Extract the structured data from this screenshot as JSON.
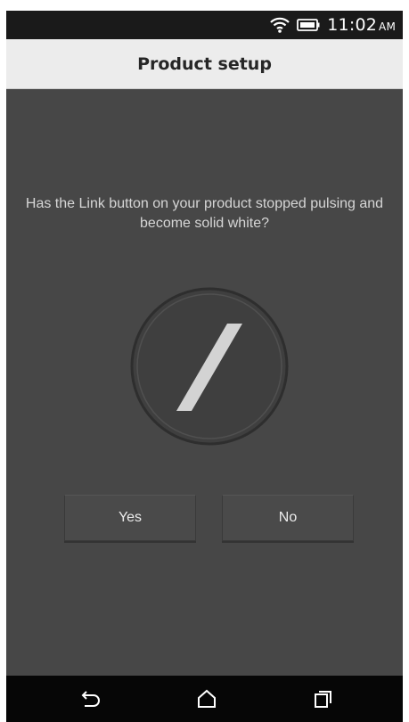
{
  "status_bar": {
    "time": "11:02",
    "ampm": "AM",
    "wifi_icon": "wifi-icon",
    "battery_icon": "battery-icon"
  },
  "header": {
    "title": "Product setup"
  },
  "main": {
    "question": "Has the Link button on your product stopped pulsing and become solid white?",
    "graphic_icon": "link-button-indicator-icon",
    "yes_label": "Yes",
    "no_label": "No"
  },
  "nav_bar": {
    "back_icon": "back-icon",
    "home_icon": "home-icon",
    "recents_icon": "recent-apps-icon"
  },
  "colors": {
    "background": "#474747",
    "header_bg": "#ececec",
    "status_bg": "#1a1a1a",
    "nav_bg": "#060606"
  }
}
